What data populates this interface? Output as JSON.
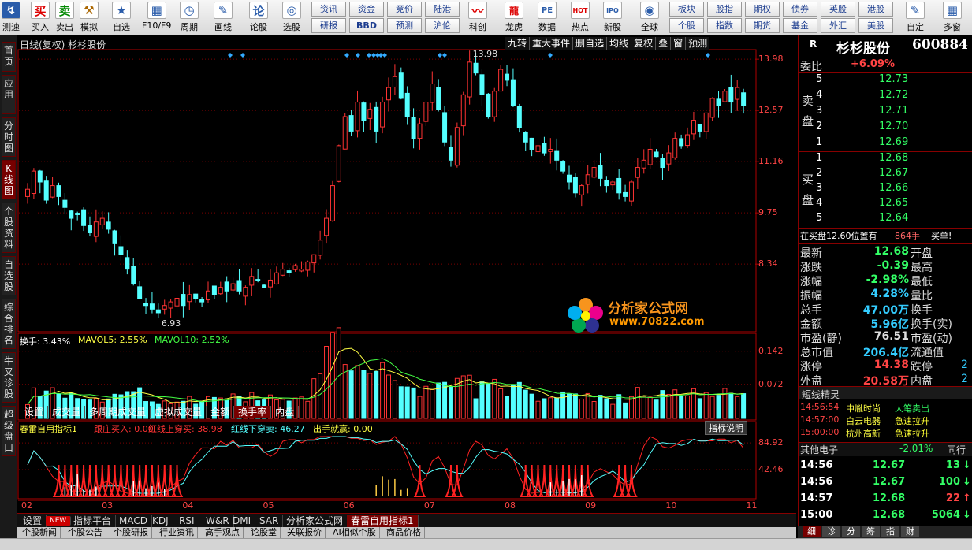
{
  "toolbar": {
    "buttons": [
      {
        "label": "测速",
        "icon": "speed-icon"
      },
      {
        "label": "买入",
        "icon": "buy-icon",
        "glyph": "买"
      },
      {
        "label": "卖出",
        "icon": "sell-icon",
        "glyph": "卖"
      },
      {
        "label": "模拟",
        "icon": "hammer-icon",
        "glyph": "⚒"
      },
      {
        "label": "自选",
        "icon": "star-icon",
        "glyph": "★"
      },
      {
        "label": "F10/F9",
        "icon": "window-icon",
        "glyph": "▦"
      },
      {
        "label": "周期",
        "icon": "clock-icon",
        "glyph": "◷"
      },
      {
        "label": "画线",
        "icon": "pen-icon",
        "glyph": "✎"
      },
      {
        "label": "论股",
        "icon": "forum-icon",
        "glyph": "论"
      },
      {
        "label": "选股",
        "icon": "magnifier-icon",
        "glyph": "◎"
      }
    ],
    "small_top": [
      "资讯",
      "资金",
      "竞价",
      "陆港"
    ],
    "small_bottom": [
      "研报",
      "BBD",
      "预测",
      "沪伦"
    ],
    "mid_buttons": [
      {
        "label": "科创",
        "icon": "kechuang-icon",
        "glyph": "〰"
      },
      {
        "label": "龙虎",
        "icon": "dragon-icon",
        "glyph": "龍"
      },
      {
        "label": "数据",
        "icon": "data-icon",
        "glyph": "PE"
      },
      {
        "label": "热点",
        "icon": "hot-icon",
        "glyph": "HOT"
      },
      {
        "label": "新股",
        "icon": "newstock-icon",
        "glyph": "IPO"
      }
    ],
    "global": {
      "label": "全球",
      "glyph": "◉"
    },
    "small2_top": [
      "板块",
      "股指",
      "期权",
      "债券",
      "英股",
      "港股"
    ],
    "small2_bottom": [
      "个股",
      "指数",
      "期货",
      "基金",
      "外汇",
      "美股"
    ],
    "right_buttons": [
      {
        "label": "自定",
        "glyph": "✎"
      },
      {
        "label": "多窗",
        "glyph": "▦"
      }
    ]
  },
  "left_nav": [
    "首页",
    "应用",
    "分时图",
    "K线图",
    "个股资料",
    "自选股",
    "综合排名",
    "牛叉诊股",
    "超级盘口"
  ],
  "chart_header": {
    "title": "日线(复权) 杉杉股份",
    "buttons": [
      "九转",
      "重大事件",
      "删自选",
      "均线",
      "复权",
      "叠",
      "窗",
      "预测"
    ]
  },
  "price_axis": [
    "13.98",
    "12.57",
    "11.16",
    "9.75",
    "8.34"
  ],
  "price_marks": {
    "high": "13.98",
    "low": "6.93"
  },
  "volume_indicator": {
    "label": "换手: 3.43%",
    "mavol5": "MAVOL5: 2.55%",
    "mavol10": "MAVOL10: 2.52%",
    "ticks": [
      "0.142",
      "0.072"
    ]
  },
  "volume_tabs": [
    "设置",
    "成交量",
    "多周期成交量",
    "虚拟成交量",
    "金额",
    "换手率",
    "内盘"
  ],
  "indicator": {
    "name": "春雷自用指标1",
    "v1": "跟庄买入: 0.00",
    "v2": "红线上穿买: 38.98",
    "v3": "红线下穿卖: 46.27",
    "v4": "出手就赢: 0.00",
    "help": "指标说明",
    "ticks": [
      "84.92",
      "42.46"
    ]
  },
  "x_axis": [
    "02",
    "03",
    "04",
    "05",
    "06",
    "07",
    "08",
    "09",
    "10",
    "11"
  ],
  "bottom_tabs": [
    "设置",
    "NEW",
    "指标平台",
    "MACD",
    "KDJ",
    "RSI",
    "W&R",
    "DMI",
    "SAR",
    "分析家公式网",
    "春雷自用指标1"
  ],
  "bottom_tabs2": [
    "个股新闻",
    "个股公告",
    "个股研报",
    "行业资讯",
    "高手观点",
    "论股堂",
    "关联报价",
    "AI相似个股",
    "商品价格"
  ],
  "watermark": {
    "cn": "分析家公式网",
    "url": "www.70822.com"
  },
  "quote": {
    "badge": "R",
    "name": "杉杉股份",
    "code": "600884",
    "weibi_label": "委比",
    "weibi": "+6.09%",
    "sell_label": "卖盘",
    "buy_label": "买盘",
    "asks": [
      {
        "lvl": "5",
        "price": "12.73"
      },
      {
        "lvl": "4",
        "price": "12.72"
      },
      {
        "lvl": "3",
        "price": "12.71"
      },
      {
        "lvl": "2",
        "price": "12.70"
      },
      {
        "lvl": "1",
        "price": "12.69"
      }
    ],
    "bids": [
      {
        "lvl": "1",
        "price": "12.68"
      },
      {
        "lvl": "2",
        "price": "12.67"
      },
      {
        "lvl": "3",
        "price": "12.66"
      },
      {
        "lvl": "4",
        "price": "12.65"
      },
      {
        "lvl": "5",
        "price": "12.64"
      }
    ],
    "notice": "在买盘12.60位置有",
    "notice_vol": "864手",
    "notice_act": "买单!",
    "stats": [
      {
        "k": "最新",
        "v": "12.68",
        "k2": "开盘",
        "c": "#33ff66"
      },
      {
        "k": "涨跌",
        "v": "-0.39",
        "k2": "最高",
        "c": "#33ff66"
      },
      {
        "k": "涨幅",
        "v": "-2.98%",
        "k2": "最低",
        "c": "#33ff66"
      },
      {
        "k": "振幅",
        "v": "4.28%",
        "k2": "量比",
        "c": "#33ccff"
      },
      {
        "k": "总手",
        "v": "47.00万",
        "k2": "换手",
        "c": "#33ccff"
      },
      {
        "k": "金额",
        "v": "5.96亿",
        "k2": "换手(实)",
        "c": "#33ccff"
      },
      {
        "k": "市盈(静)",
        "v": "76.51",
        "k2": "市盈(动)",
        "c": "#dddddd"
      },
      {
        "k": "总市值",
        "v": "206.4亿",
        "k2": "流通值",
        "c": "#33ccff"
      },
      {
        "k": "涨停",
        "v": "14.38",
        "k2": "跌停",
        "c": "#ff4444"
      },
      {
        "k": "外盘",
        "v": "20.58万",
        "k2": "内盘",
        "c": "#ff4444"
      }
    ],
    "stat_tail": [
      "2",
      "2"
    ],
    "alerts_title": "短线精灵",
    "alerts": [
      {
        "t": "14:56:54",
        "n": "中胤时尚",
        "a": "大笔卖出",
        "ac": "#33ff66"
      },
      {
        "t": "14:57:00",
        "n": "白云电器",
        "a": "急速拉升",
        "ac": "#ffff33"
      },
      {
        "t": "15:00:00",
        "n": "杭州高新",
        "a": "急速拉升",
        "ac": "#ffff33"
      }
    ],
    "sector": {
      "name": "其他电子",
      "chg": "-2.01%",
      "btn": "同行"
    },
    "ticks": [
      {
        "t": "14:56",
        "p": "12.67",
        "v": "13",
        "d": "↓",
        "c": "#33ff66"
      },
      {
        "t": "14:56",
        "p": "12.67",
        "v": "100",
        "d": "↓",
        "c": "#33ff66"
      },
      {
        "t": "14:57",
        "p": "12.68",
        "v": "22",
        "d": "↑",
        "c": "#ff4444"
      },
      {
        "t": "15:00",
        "p": "12.68",
        "v": "5064",
        "d": "↓",
        "c": "#33ff66"
      }
    ],
    "tabs": [
      "细",
      "诊",
      "分",
      "筹",
      "指",
      "财"
    ]
  },
  "colors": {
    "up": "#ff3333",
    "down": "#54ffff",
    "bg": "#000000",
    "grid": "#7a0000",
    "axis": "#b00000"
  },
  "chart_data": {
    "type": "candlestick",
    "x": [
      "02",
      "03",
      "04",
      "05",
      "06",
      "07",
      "08",
      "09",
      "10",
      "11"
    ],
    "ylim": [
      6.5,
      14.2
    ],
    "close": [
      10.4,
      10.9,
      10.6,
      10.1,
      10.5,
      10.2,
      9.9,
      9.6,
      9.7,
      9.4,
      9.2,
      9.5,
      9.6,
      9.3,
      8.9,
      8.6,
      8.2,
      7.8,
      7.4,
      7.2,
      7.1,
      7.0,
      7.2,
      7.3,
      7.4,
      7.2,
      7.5,
      7.4,
      7.3,
      7.6,
      7.5,
      7.7,
      7.6,
      7.8,
      7.6,
      7.7,
      8.0,
      7.9,
      7.7,
      7.9,
      8.1,
      8.2,
      8.1,
      8.3,
      8.2,
      8.4,
      8.6,
      9.0,
      9.6,
      10.5,
      11.6,
      12.4,
      12.0,
      12.8,
      12.3,
      12.6,
      12.0,
      12.8,
      13.2,
      13.5,
      12.9,
      12.4,
      11.8,
      12.2,
      12.8,
      13.3,
      12.6,
      11.7,
      11.2,
      12.1,
      13.0,
      13.9,
      13.6,
      13.0,
      12.4,
      13.1,
      13.7,
      13.4,
      12.7,
      12.1,
      11.7,
      11.5,
      11.6,
      11.4,
      11.5,
      11.2,
      10.9,
      10.6,
      10.3,
      10.5,
      10.8,
      11.0,
      10.7,
      10.5,
      10.6,
      10.3,
      10.2,
      10.6,
      11.0,
      11.2,
      11.5,
      11.3,
      11.0,
      11.4,
      11.8,
      11.6,
      11.9,
      12.3,
      12.0,
      12.5,
      12.9,
      12.7,
      13.1,
      12.8,
      13.2,
      12.7
    ]
  }
}
